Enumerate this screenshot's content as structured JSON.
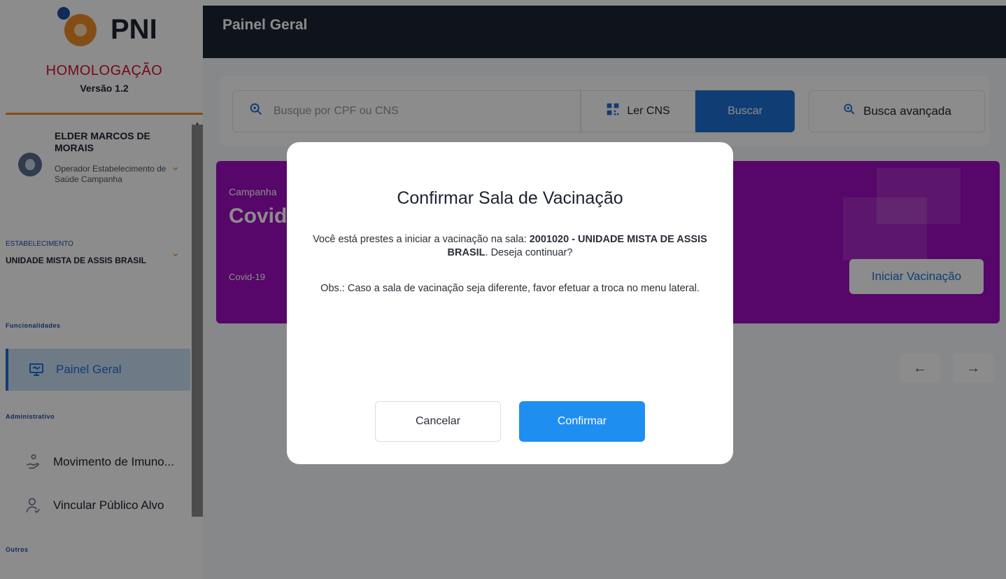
{
  "sidebar": {
    "logo_text": "PNI",
    "environment": "HOMOLOGAÇÃO",
    "version": "Versão 1.2",
    "user": {
      "name": "ELDER MARCOS DE MORAIS",
      "role": "Operador Estabelecimento de Saúde Campanha"
    },
    "establishment": {
      "label": "ESTABELECIMENTO",
      "name": "UNIDADE MISTA DE ASSIS BRASIL"
    },
    "sections": {
      "funcionalidades": "Funcionalidades",
      "administrativo": "Administrativo",
      "outros": "Outros"
    },
    "items": [
      {
        "label": "Painel Geral",
        "icon": "presentation-icon"
      },
      {
        "label": "Movimento de Imuno...",
        "icon": "hand-drop-icon"
      },
      {
        "label": "Vincular Público Alvo",
        "icon": "user-link-icon"
      }
    ]
  },
  "header": {
    "title": "Painel Geral"
  },
  "search": {
    "placeholder": "Busque por CPF ou CNS",
    "ler_cns": "Ler CNS",
    "buscar": "Buscar",
    "busca_avancada": "Busca avançada"
  },
  "campaign": {
    "label": "Campanha",
    "title": "Covid",
    "subtitle": "Covid-19",
    "start_button": "Iniciar Vacinação"
  },
  "pager": {
    "prev": "←",
    "next": "→"
  },
  "modal": {
    "title": "Confirmar Sala de Vacinação",
    "text_prefix": "Você está prestes a iniciar a vacinação na sala: ",
    "room": "2001020 - UNIDADE MISTA DE ASSIS BRASIL",
    "text_suffix": ". Deseja continuar?",
    "note_label": "Obs.:",
    "note_text": " Caso a sala de vacinação seja diferente, favor efetuar a troca no menu lateral.",
    "cancel": "Cancelar",
    "confirm": "Confirmar"
  },
  "colors": {
    "primary": "#1f6fd6",
    "topbar": "#1d2633",
    "campaign": "#9d0ec0",
    "env_red": "#d9102a",
    "accent_orange": "#f28c28"
  }
}
